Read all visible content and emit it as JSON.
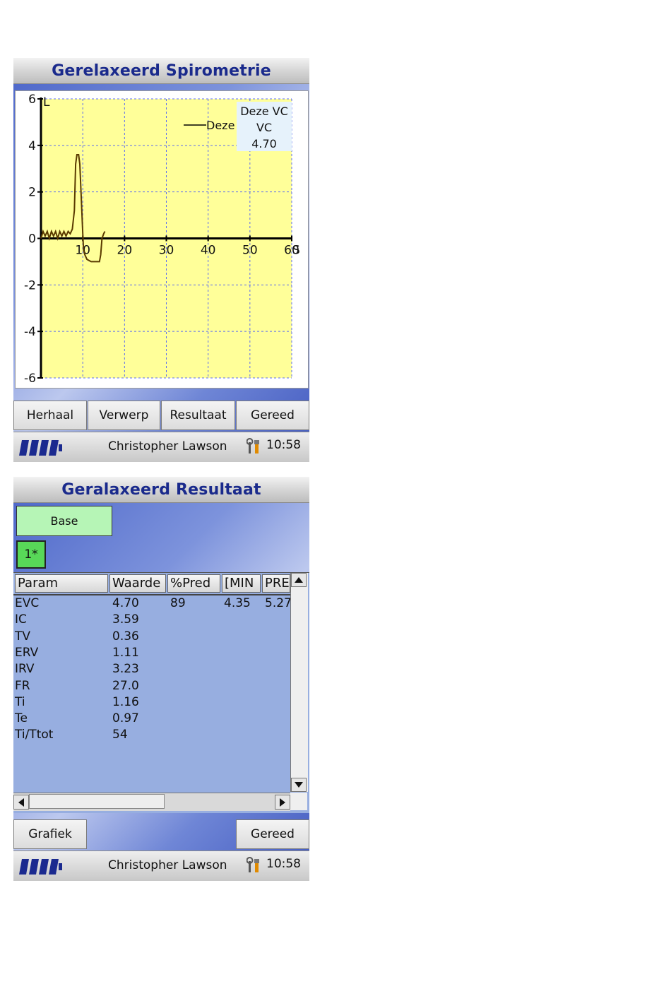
{
  "screen1": {
    "title": "Gerelaxeerd Spirometrie",
    "buttons": [
      "Herhaal",
      "Verwerp",
      "Resultaat",
      "Gereed"
    ],
    "status": {
      "user": "Christopher Lawson",
      "time": "10:58"
    }
  },
  "chart_data": {
    "type": "line",
    "title": "",
    "xlabel": "S",
    "ylabel": "L",
    "xlim": [
      0,
      60
    ],
    "ylim": [
      -6,
      6
    ],
    "xticks": [
      "10",
      "20",
      "30",
      "40",
      "50",
      "60"
    ],
    "yticks": [
      "6",
      "4",
      "2",
      "0",
      "-2",
      "-4",
      "-6"
    ],
    "grid": true,
    "background": "#ffff99",
    "series": [
      {
        "name": "Deze",
        "color": "#5a3a00",
        "points": [
          [
            0,
            0
          ],
          [
            0.5,
            0.3
          ],
          [
            1,
            0.1
          ],
          [
            1.5,
            0.3
          ],
          [
            2,
            0
          ],
          [
            2.5,
            0.3
          ],
          [
            3,
            0.1
          ],
          [
            3.5,
            0.3
          ],
          [
            4,
            0
          ],
          [
            4.5,
            0.3
          ],
          [
            5,
            0.1
          ],
          [
            5.5,
            0.3
          ],
          [
            6,
            0.1
          ],
          [
            6.5,
            0.3
          ],
          [
            7,
            0.2
          ],
          [
            7.5,
            0.4
          ],
          [
            8,
            1.2
          ],
          [
            8.3,
            3.2
          ],
          [
            8.6,
            3.6
          ],
          [
            9,
            3.6
          ],
          [
            9.3,
            3.2
          ],
          [
            9.7,
            1.5
          ],
          [
            10,
            0.2
          ],
          [
            10.2,
            -0.5
          ],
          [
            10.5,
            -0.7
          ],
          [
            11,
            -0.9
          ],
          [
            12,
            -1.0
          ],
          [
            13,
            -1.0
          ],
          [
            14,
            -1.0
          ],
          [
            14.3,
            -0.7
          ],
          [
            14.6,
            0
          ],
          [
            15,
            0.2
          ],
          [
            15.3,
            0.3
          ]
        ]
      }
    ],
    "legend": {
      "position": "top-right",
      "label": "Deze",
      "box_lines": [
        "Deze VC",
        "VC",
        "4.70"
      ]
    }
  },
  "screen2": {
    "title": "Geralaxeerd Resultaat",
    "base_label": "Base",
    "trial_label": "1*",
    "columns": [
      "Param",
      "Waarde",
      "%Pred",
      "[MIN",
      "PRE"
    ],
    "rows": [
      {
        "param": "EVC",
        "value": "4.70",
        "pred": "89",
        "min": "4.35",
        "pre": "5.27"
      },
      {
        "param": "IC",
        "value": "3.59"
      },
      {
        "param": "TV",
        "value": "0.36"
      },
      {
        "param": "ERV",
        "value": "1.11"
      },
      {
        "param": "IRV",
        "value": "3.23"
      },
      {
        "param": "FR",
        "value": "27.0"
      },
      {
        "param": "Ti",
        "value": "1.16"
      },
      {
        "param": "Te",
        "value": "0.97"
      },
      {
        "param": "Ti/Ttot",
        "value": " 54"
      }
    ],
    "buttons": {
      "left": "Grafiek",
      "right": "Gereed"
    },
    "status": {
      "user": "Christopher Lawson",
      "time": "10:58"
    }
  }
}
